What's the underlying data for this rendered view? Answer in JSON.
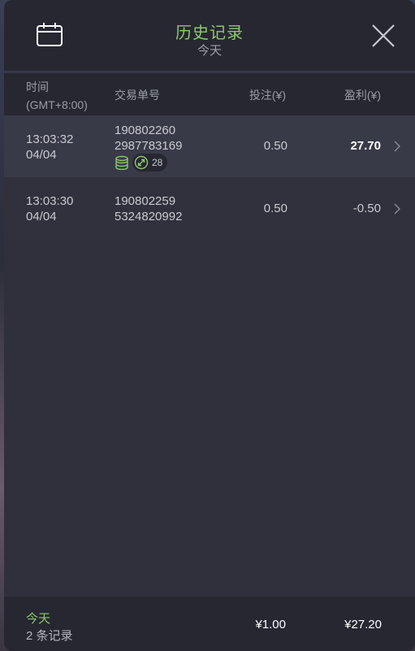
{
  "header": {
    "title": "历史记录",
    "subtitle": "今天"
  },
  "columns": {
    "time_line1": "时间",
    "time_line2": "(GMT+8:00)",
    "order": "交易单号",
    "stake": "投注(¥)",
    "profit": "盈利(¥)"
  },
  "rows": [
    {
      "time": "13:03:32",
      "date": "04/04",
      "order_line1": "190802260",
      "order_line2": "2987783169",
      "multiplier_count": "28",
      "stake": "0.50",
      "profit": "27.70"
    },
    {
      "time": "13:03:30",
      "date": "04/04",
      "order_line1": "190802259",
      "order_line2": "5324820992",
      "stake": "0.50",
      "profit": "-0.50"
    }
  ],
  "footer": {
    "period": "今天",
    "record_count": "2 条记录",
    "total_stake": "¥1.00",
    "total_profit": "¥27.20"
  },
  "colors": {
    "accent_green": "#8fc76f",
    "panel_bg": "#2f303b",
    "header_bg": "#262731"
  },
  "icons": {
    "calendar": "calendar-icon",
    "close": "close-icon",
    "coins": "coins-icon",
    "multiplier": "multiplier-icon",
    "chevron": "chevron-right-icon"
  }
}
